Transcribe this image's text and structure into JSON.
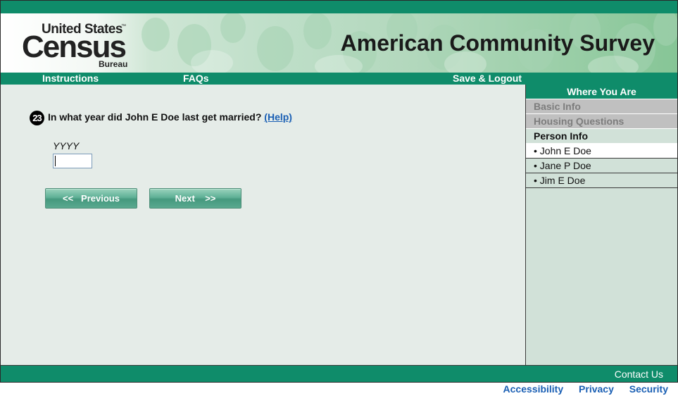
{
  "header": {
    "logo": {
      "line1": "United States",
      "trademark": "™",
      "line2": "Census",
      "line3": "Bureau"
    },
    "survey_title": "American Community Survey"
  },
  "nav": {
    "instructions": "Instructions",
    "faqs": "FAQs",
    "save_logout": "Save & Logout"
  },
  "question": {
    "number": "23",
    "text": "In what year did John E Doe last get married?",
    "help": "(Help)",
    "field_label": "YYYY",
    "field_value": ""
  },
  "buttons": {
    "previous": "<<   Previous",
    "next": "Next    >>"
  },
  "sidebar": {
    "header": "Where You Are",
    "basic_info": "Basic Info",
    "housing_questions": "Housing Questions",
    "person_info": "Person Info",
    "persons": [
      "• John E Doe",
      "• Jane P Doe",
      "• Jim E Doe"
    ]
  },
  "footer": {
    "contact": "Contact Us",
    "links": [
      "Accessibility",
      "Privacy",
      "Security"
    ]
  },
  "colors": {
    "brand_green": "#0f8c6a",
    "link_blue": "#1a5fb4",
    "content_bg": "#e5ece8",
    "sidebar_bg": "#d1e1d8"
  }
}
